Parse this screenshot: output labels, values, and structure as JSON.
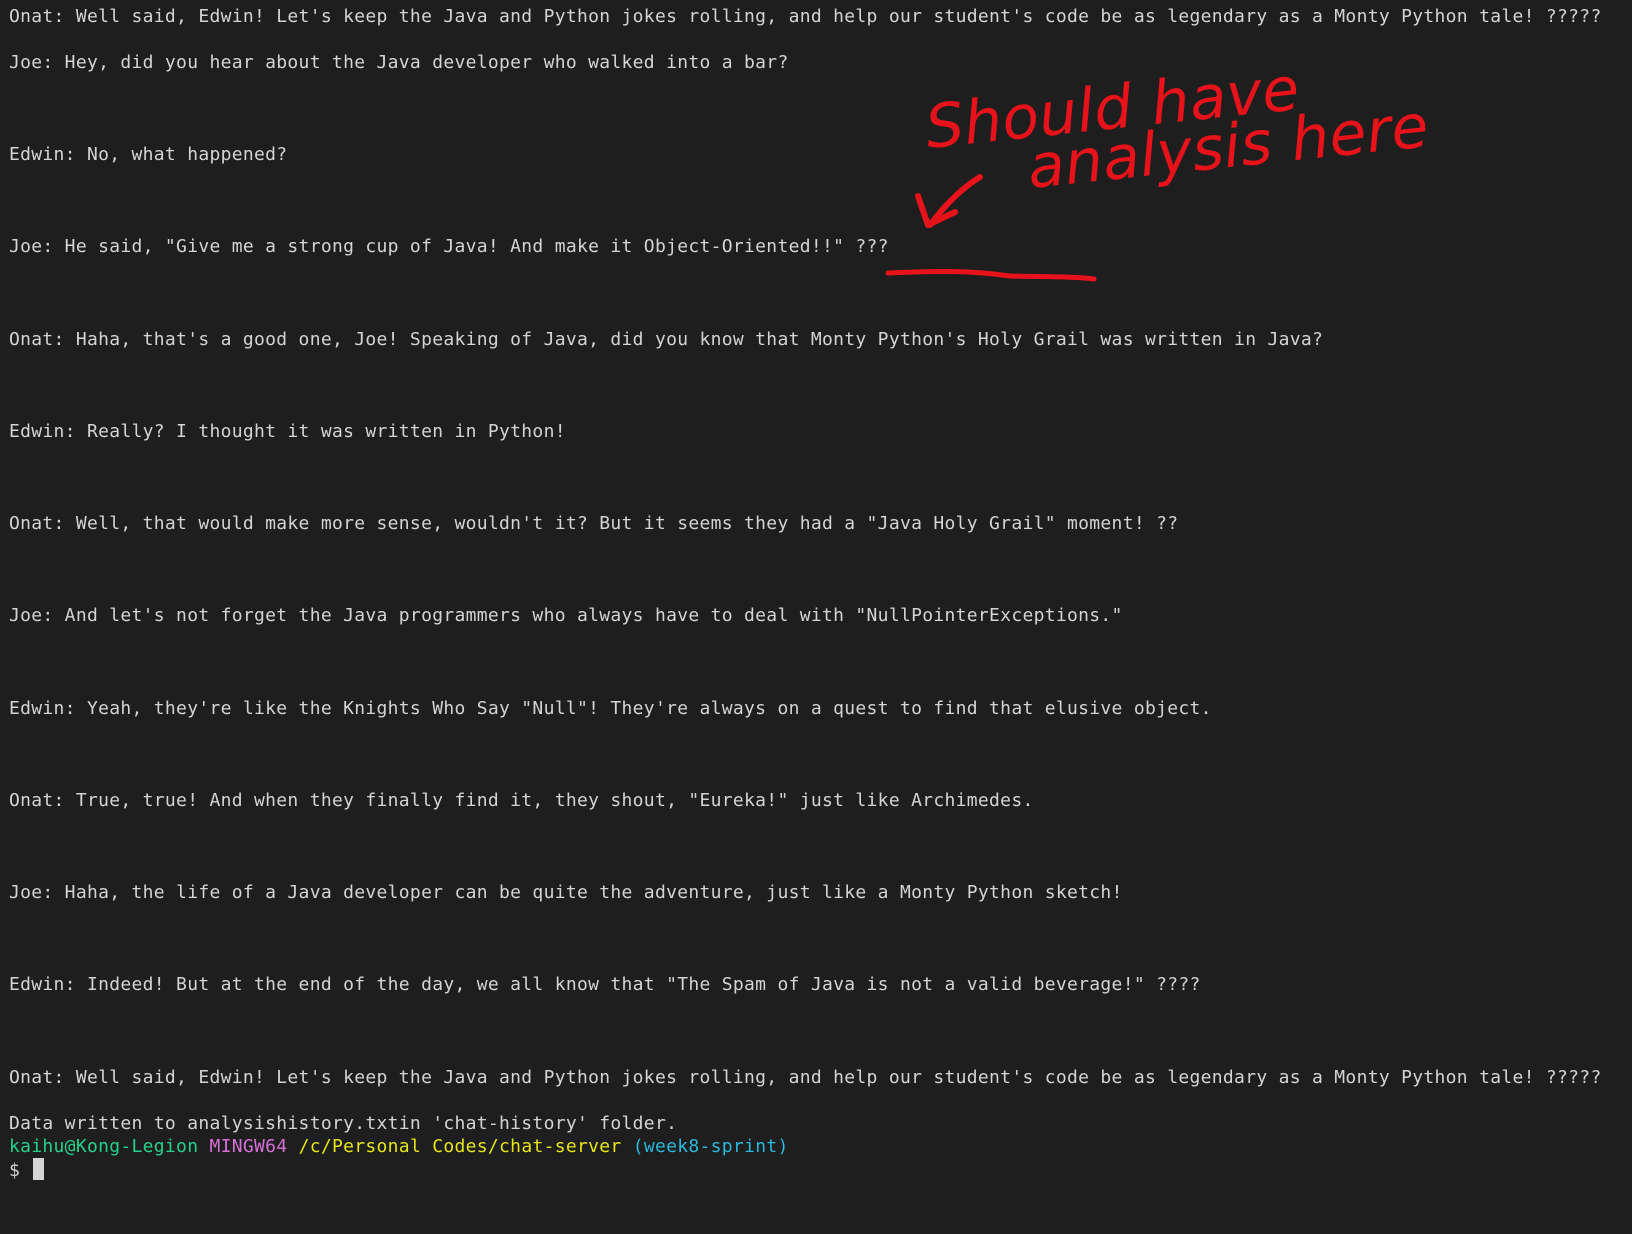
{
  "terminal": {
    "lines": [
      "Onat: Well said, Edwin! Let's keep the Java and Python jokes rolling, and help our student's code be as legendary as a Monty Python tale! ?????",
      "Joe: Hey, did you hear about the Java developer who walked into a bar?",
      "Edwin: No, what happened?",
      "Joe: He said, \"Give me a strong cup of Java! And make it Object-Oriented!!\" ???",
      "Onat: Haha, that's a good one, Joe! Speaking of Java, did you know that Monty Python's Holy Grail was written in Java?",
      "Edwin: Really? I thought it was written in Python!",
      "Onat: Well, that would make more sense, wouldn't it? But it seems they had a \"Java Holy Grail\" moment! ??",
      "Joe: And let's not forget the Java programmers who always have to deal with \"NullPointerExceptions.\"",
      "Edwin: Yeah, they're like the Knights Who Say \"Null\"! They're always on a quest to find that elusive object.",
      "Onat: True, true! And when they finally find it, they shout, \"Eureka!\" just like Archimedes.",
      "Joe: Haha, the life of a Java developer can be quite the adventure, just like a Monty Python sketch!",
      "Edwin: Indeed! But at the end of the day, we all know that \"The Spam of Java is not a valid beverage!\" ????",
      "Onat: Well said, Edwin! Let's keep the Java and Python jokes rolling, and help our student's code be as legendary as a Monty Python tale! ?????"
    ],
    "status_message": "Data written to analysishistory.txtin 'chat-history' folder.",
    "prompt": {
      "user_host": "kaihu@Kong-Legion",
      "env": "MINGW64",
      "path": "/c/Personal Codes/chat-server",
      "branch": "(week8-sprint)",
      "symbol": "$"
    },
    "colors": {
      "background": "#1e1e1e",
      "text": "#d4d4d4",
      "user_host": "#23d18b",
      "env": "#d670d6",
      "path": "#e5e510",
      "branch": "#29b8db",
      "annotation": "#e8121b"
    }
  },
  "annotation": {
    "line1": "Should have",
    "line2": "analysis here"
  }
}
